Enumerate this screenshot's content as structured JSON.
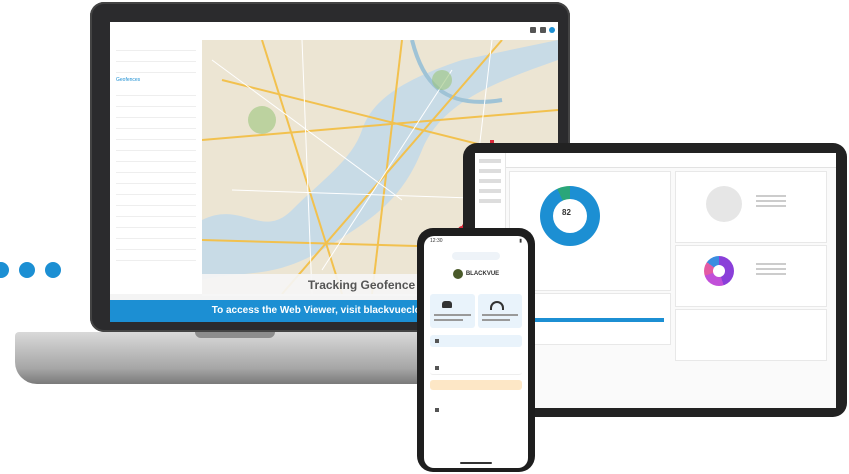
{
  "laptop": {
    "window_title": "",
    "sidebar_tab_active": "Geofences",
    "map_caption": "Tracking Geofence Alerts",
    "banner": "To access the Web Viewer, visit blackvuecloud.com"
  },
  "tablet": {
    "topbar_title": "",
    "donut_value": "82"
  },
  "phone": {
    "status_time": "12:30",
    "header": "",
    "logo_text": "BLACKVUE",
    "button_label": "",
    "alert_label": ""
  },
  "colors": {
    "accent": "#1c8fd3",
    "route": "#d8283a",
    "map_bg": "#eae3d2"
  }
}
